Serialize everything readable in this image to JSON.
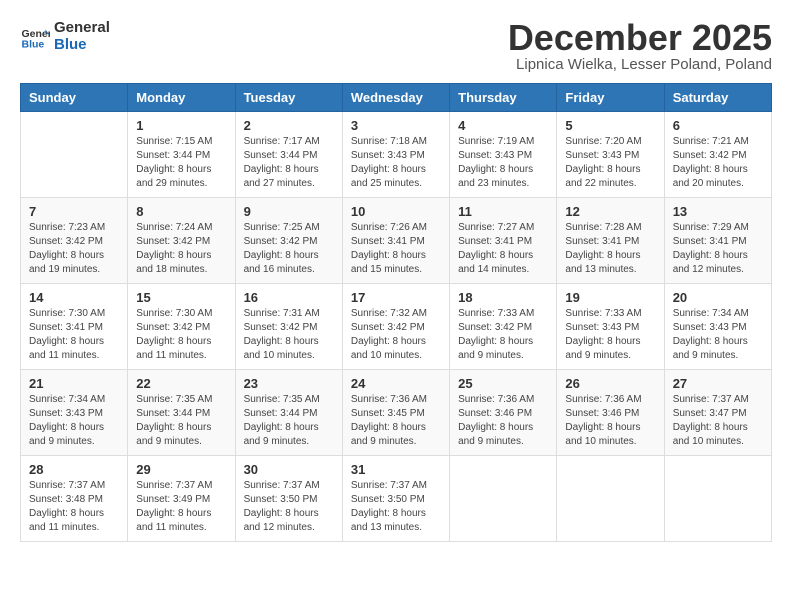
{
  "logo": {
    "line1": "General",
    "line2": "Blue"
  },
  "title": "December 2025",
  "location": "Lipnica Wielka, Lesser Poland, Poland",
  "days_of_week": [
    "Sunday",
    "Monday",
    "Tuesday",
    "Wednesday",
    "Thursday",
    "Friday",
    "Saturday"
  ],
  "weeks": [
    [
      {
        "num": "",
        "sunrise": "",
        "sunset": "",
        "daylight": ""
      },
      {
        "num": "1",
        "sunrise": "Sunrise: 7:15 AM",
        "sunset": "Sunset: 3:44 PM",
        "daylight": "Daylight: 8 hours and 29 minutes."
      },
      {
        "num": "2",
        "sunrise": "Sunrise: 7:17 AM",
        "sunset": "Sunset: 3:44 PM",
        "daylight": "Daylight: 8 hours and 27 minutes."
      },
      {
        "num": "3",
        "sunrise": "Sunrise: 7:18 AM",
        "sunset": "Sunset: 3:43 PM",
        "daylight": "Daylight: 8 hours and 25 minutes."
      },
      {
        "num": "4",
        "sunrise": "Sunrise: 7:19 AM",
        "sunset": "Sunset: 3:43 PM",
        "daylight": "Daylight: 8 hours and 23 minutes."
      },
      {
        "num": "5",
        "sunrise": "Sunrise: 7:20 AM",
        "sunset": "Sunset: 3:43 PM",
        "daylight": "Daylight: 8 hours and 22 minutes."
      },
      {
        "num": "6",
        "sunrise": "Sunrise: 7:21 AM",
        "sunset": "Sunset: 3:42 PM",
        "daylight": "Daylight: 8 hours and 20 minutes."
      }
    ],
    [
      {
        "num": "7",
        "sunrise": "Sunrise: 7:23 AM",
        "sunset": "Sunset: 3:42 PM",
        "daylight": "Daylight: 8 hours and 19 minutes."
      },
      {
        "num": "8",
        "sunrise": "Sunrise: 7:24 AM",
        "sunset": "Sunset: 3:42 PM",
        "daylight": "Daylight: 8 hours and 18 minutes."
      },
      {
        "num": "9",
        "sunrise": "Sunrise: 7:25 AM",
        "sunset": "Sunset: 3:42 PM",
        "daylight": "Daylight: 8 hours and 16 minutes."
      },
      {
        "num": "10",
        "sunrise": "Sunrise: 7:26 AM",
        "sunset": "Sunset: 3:41 PM",
        "daylight": "Daylight: 8 hours and 15 minutes."
      },
      {
        "num": "11",
        "sunrise": "Sunrise: 7:27 AM",
        "sunset": "Sunset: 3:41 PM",
        "daylight": "Daylight: 8 hours and 14 minutes."
      },
      {
        "num": "12",
        "sunrise": "Sunrise: 7:28 AM",
        "sunset": "Sunset: 3:41 PM",
        "daylight": "Daylight: 8 hours and 13 minutes."
      },
      {
        "num": "13",
        "sunrise": "Sunrise: 7:29 AM",
        "sunset": "Sunset: 3:41 PM",
        "daylight": "Daylight: 8 hours and 12 minutes."
      }
    ],
    [
      {
        "num": "14",
        "sunrise": "Sunrise: 7:30 AM",
        "sunset": "Sunset: 3:41 PM",
        "daylight": "Daylight: 8 hours and 11 minutes."
      },
      {
        "num": "15",
        "sunrise": "Sunrise: 7:30 AM",
        "sunset": "Sunset: 3:42 PM",
        "daylight": "Daylight: 8 hours and 11 minutes."
      },
      {
        "num": "16",
        "sunrise": "Sunrise: 7:31 AM",
        "sunset": "Sunset: 3:42 PM",
        "daylight": "Daylight: 8 hours and 10 minutes."
      },
      {
        "num": "17",
        "sunrise": "Sunrise: 7:32 AM",
        "sunset": "Sunset: 3:42 PM",
        "daylight": "Daylight: 8 hours and 10 minutes."
      },
      {
        "num": "18",
        "sunrise": "Sunrise: 7:33 AM",
        "sunset": "Sunset: 3:42 PM",
        "daylight": "Daylight: 8 hours and 9 minutes."
      },
      {
        "num": "19",
        "sunrise": "Sunrise: 7:33 AM",
        "sunset": "Sunset: 3:43 PM",
        "daylight": "Daylight: 8 hours and 9 minutes."
      },
      {
        "num": "20",
        "sunrise": "Sunrise: 7:34 AM",
        "sunset": "Sunset: 3:43 PM",
        "daylight": "Daylight: 8 hours and 9 minutes."
      }
    ],
    [
      {
        "num": "21",
        "sunrise": "Sunrise: 7:34 AM",
        "sunset": "Sunset: 3:43 PM",
        "daylight": "Daylight: 8 hours and 9 minutes."
      },
      {
        "num": "22",
        "sunrise": "Sunrise: 7:35 AM",
        "sunset": "Sunset: 3:44 PM",
        "daylight": "Daylight: 8 hours and 9 minutes."
      },
      {
        "num": "23",
        "sunrise": "Sunrise: 7:35 AM",
        "sunset": "Sunset: 3:44 PM",
        "daylight": "Daylight: 8 hours and 9 minutes."
      },
      {
        "num": "24",
        "sunrise": "Sunrise: 7:36 AM",
        "sunset": "Sunset: 3:45 PM",
        "daylight": "Daylight: 8 hours and 9 minutes."
      },
      {
        "num": "25",
        "sunrise": "Sunrise: 7:36 AM",
        "sunset": "Sunset: 3:46 PM",
        "daylight": "Daylight: 8 hours and 9 minutes."
      },
      {
        "num": "26",
        "sunrise": "Sunrise: 7:36 AM",
        "sunset": "Sunset: 3:46 PM",
        "daylight": "Daylight: 8 hours and 10 minutes."
      },
      {
        "num": "27",
        "sunrise": "Sunrise: 7:37 AM",
        "sunset": "Sunset: 3:47 PM",
        "daylight": "Daylight: 8 hours and 10 minutes."
      }
    ],
    [
      {
        "num": "28",
        "sunrise": "Sunrise: 7:37 AM",
        "sunset": "Sunset: 3:48 PM",
        "daylight": "Daylight: 8 hours and 11 minutes."
      },
      {
        "num": "29",
        "sunrise": "Sunrise: 7:37 AM",
        "sunset": "Sunset: 3:49 PM",
        "daylight": "Daylight: 8 hours and 11 minutes."
      },
      {
        "num": "30",
        "sunrise": "Sunrise: 7:37 AM",
        "sunset": "Sunset: 3:50 PM",
        "daylight": "Daylight: 8 hours and 12 minutes."
      },
      {
        "num": "31",
        "sunrise": "Sunrise: 7:37 AM",
        "sunset": "Sunset: 3:50 PM",
        "daylight": "Daylight: 8 hours and 13 minutes."
      },
      {
        "num": "",
        "sunrise": "",
        "sunset": "",
        "daylight": ""
      },
      {
        "num": "",
        "sunrise": "",
        "sunset": "",
        "daylight": ""
      },
      {
        "num": "",
        "sunrise": "",
        "sunset": "",
        "daylight": ""
      }
    ]
  ]
}
